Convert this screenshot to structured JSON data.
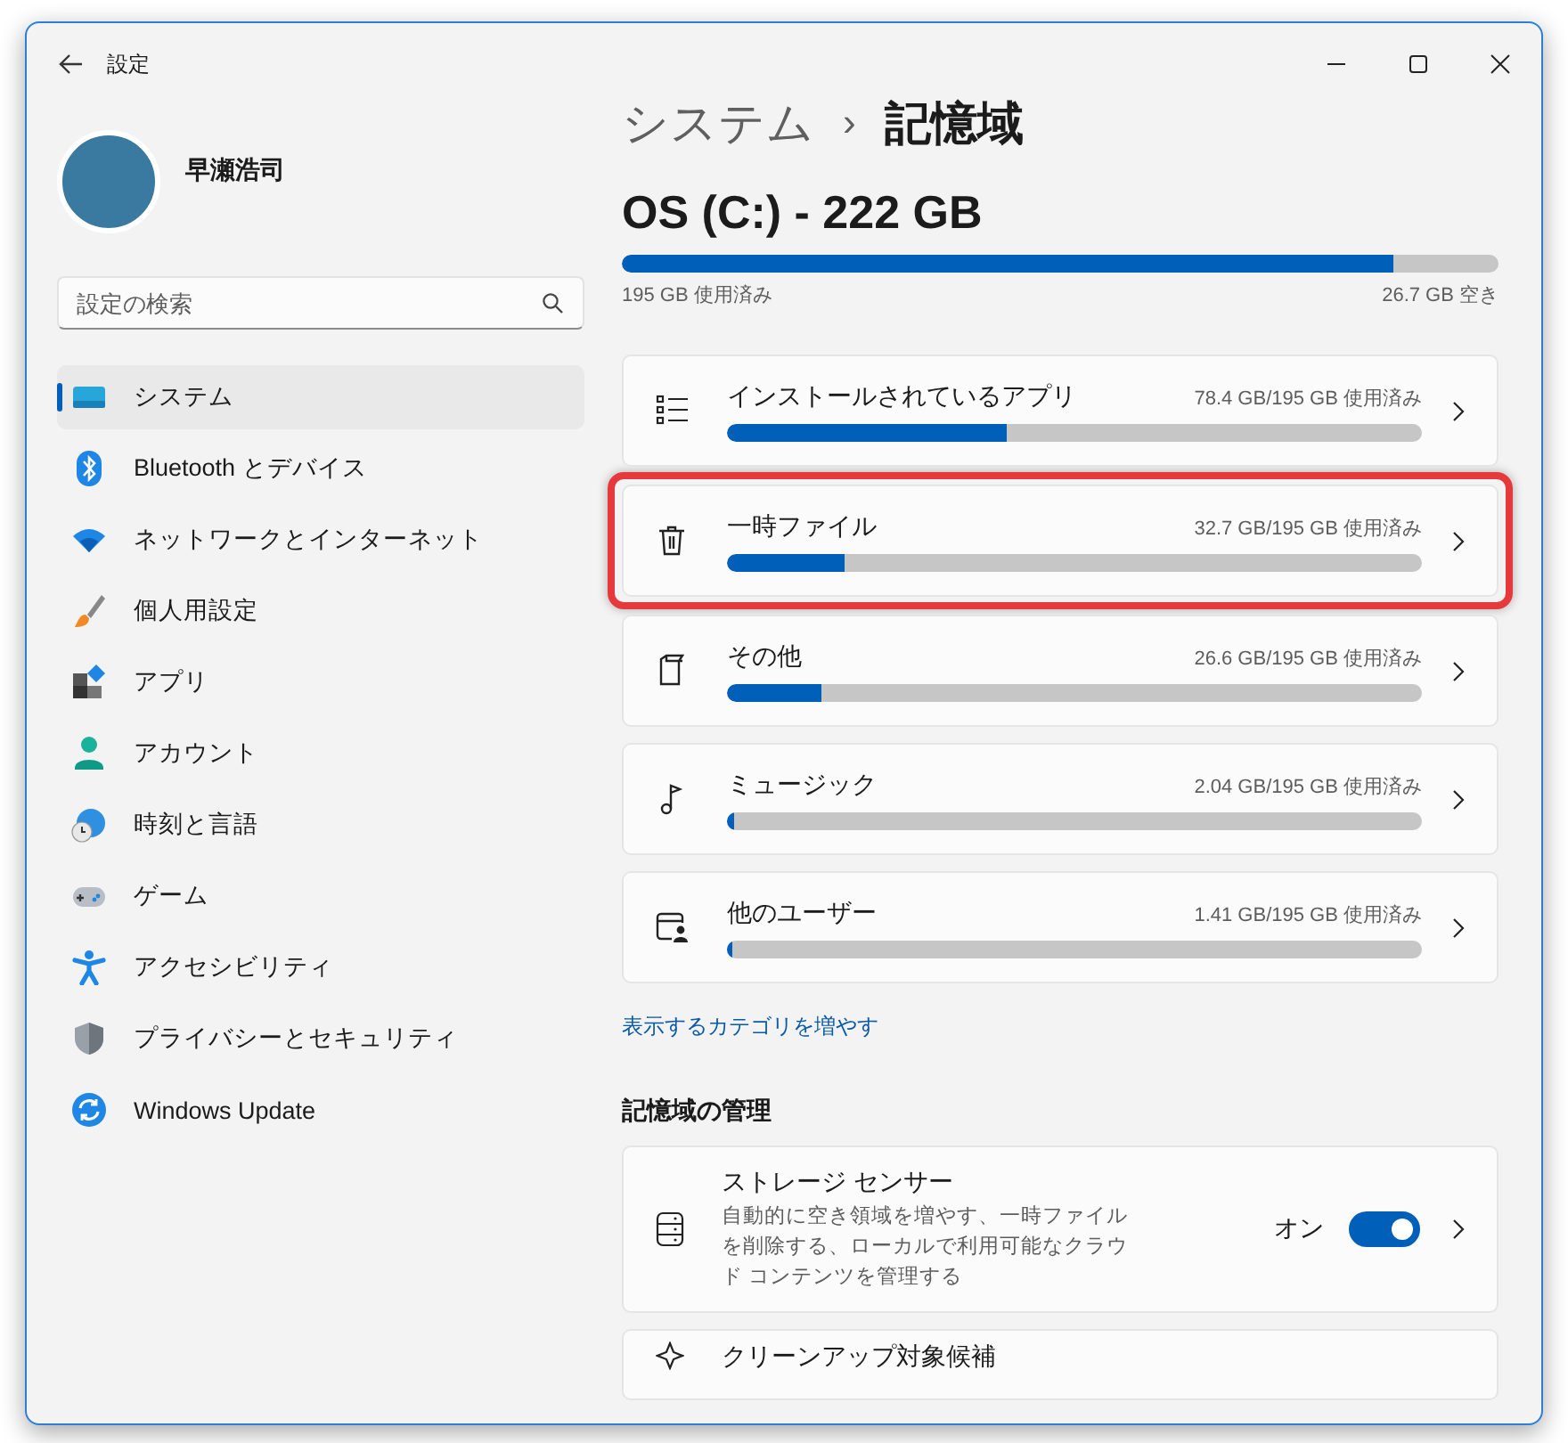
{
  "window": {
    "title": "設定"
  },
  "user": {
    "name": "早瀬浩司"
  },
  "search": {
    "placeholder": "設定の検索"
  },
  "sidebar": {
    "items": [
      {
        "label": "システム",
        "selected": true
      },
      {
        "label": "Bluetooth とデバイス",
        "selected": false
      },
      {
        "label": "ネットワークとインターネット",
        "selected": false
      },
      {
        "label": "個人用設定",
        "selected": false
      },
      {
        "label": "アプリ",
        "selected": false
      },
      {
        "label": "アカウント",
        "selected": false
      },
      {
        "label": "時刻と言語",
        "selected": false
      },
      {
        "label": "ゲーム",
        "selected": false
      },
      {
        "label": "アクセシビリティ",
        "selected": false
      },
      {
        "label": "プライバシーとセキュリティ",
        "selected": false
      },
      {
        "label": "Windows Update",
        "selected": false
      }
    ]
  },
  "breadcrumb": {
    "parent": "システム",
    "separator": "›",
    "current": "記憶域"
  },
  "drive": {
    "title": "OS (C:) - 222 GB",
    "level": 0.88,
    "used": "195 GB 使用済み",
    "free": "26.7 GB 空き"
  },
  "categories": [
    {
      "label": "インストールされているアプリ",
      "reading": "78.4 GB/195 GB 使用済み",
      "level": 0.402,
      "highlighted": false
    },
    {
      "label": "一時ファイル",
      "reading": "32.7 GB/195 GB 使用済み",
      "level": 0.168,
      "highlighted": true
    },
    {
      "label": "その他",
      "reading": "26.6 GB/195 GB 使用済み",
      "level": 0.136,
      "highlighted": false
    },
    {
      "label": "ミュージック",
      "reading": "2.04 GB/195 GB 使用済み",
      "level": 0.0105,
      "highlighted": false
    },
    {
      "label": "他のユーザー",
      "reading": "1.41 GB/195 GB 使用済み",
      "level": 0.0072,
      "highlighted": false
    }
  ],
  "more_link": "表示するカテゴリを増やす",
  "management": {
    "heading": "記憶域の管理",
    "items": [
      {
        "kind": "toggle",
        "title": "ストレージ センサー",
        "description": "自動的に空き領域を増やす、一時ファイルを削除する、ローカルで利用可能なクラウド コンテンツを管理する",
        "state_label": "オン",
        "on": true
      },
      {
        "kind": "plain",
        "title": "クリーンアップ対象候補"
      }
    ]
  }
}
